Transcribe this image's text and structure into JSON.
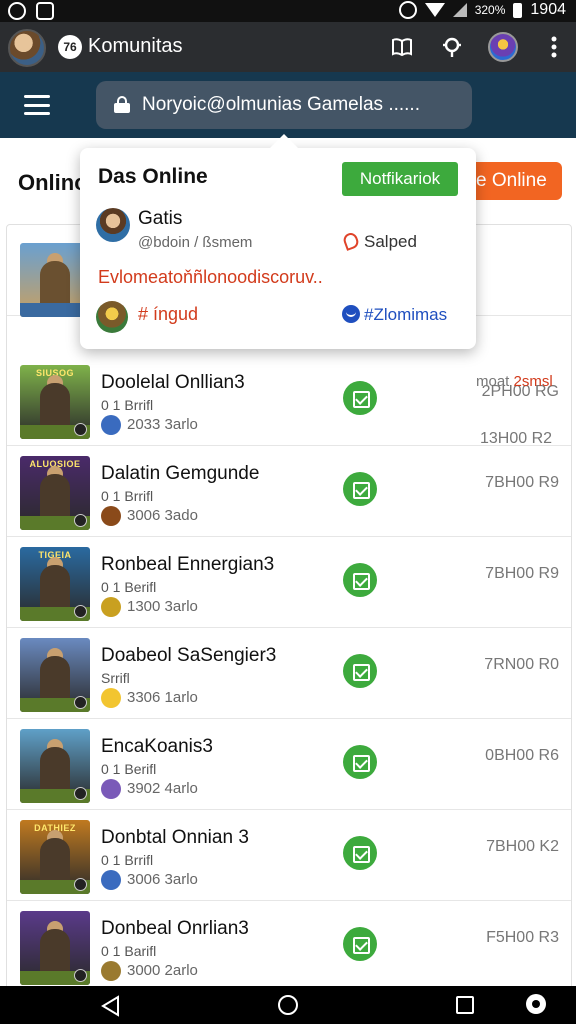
{
  "status_bar": {
    "time": "1904",
    "small": "320%"
  },
  "app_bar": {
    "logo": "76",
    "title": "Komunitas"
  },
  "search": {
    "text": "Noryoic@olmunias Gamelas ......"
  },
  "main": {
    "heading": "Onlinc",
    "online_button": "e Online"
  },
  "popup": {
    "title": "Das Online",
    "notify_button": "Notfikariok",
    "user_name": "Gatis",
    "user_handle": "@bdoin / ßsmem",
    "status": "Salped",
    "description": "Evlomeatoňñlonoodiscoruv..",
    "tag1": "# íngud",
    "tag2": "#Zlomimas"
  },
  "partial_row": {
    "text": "moat",
    "highlight": "2smsl",
    "time": "13H00 R2"
  },
  "games": [
    {
      "title": "Doolelal Onllian3",
      "sub": "0 1 Brrifl",
      "meta": "2033 3arlo",
      "time": "2PH00 RG",
      "banner": "SIUSOG",
      "sky": "#7fb24a",
      "av": "#3a6bbf"
    },
    {
      "title": "Dalatin Gemgunde",
      "sub": "0 1 Brrifl",
      "meta": "3006 3ado",
      "time": "7BH00 R9",
      "banner": "ALUOSIOE",
      "sky": "#4a2a6a",
      "av": "#8a4a1a"
    },
    {
      "title": "Ronbeal Ennergian3",
      "sub": "0 1 Berifl",
      "meta": "1300 3arlo",
      "time": "7BH00 R9",
      "banner": "TIGEIA",
      "sky": "#2a6aa0",
      "av": "#c9a020"
    },
    {
      "title": "Doabeol SaSengier3",
      "sub": "Srrifl",
      "meta": "3306 1arlo",
      "time": "7RN00 R0",
      "banner": "",
      "sky": "#6a8ac0",
      "av": "#f2c530"
    },
    {
      "title": "EncaKoanis3",
      "sub": "0 1 Berifl",
      "meta": "3902 4arlo",
      "time": "0BH00 R6",
      "banner": "",
      "sky": "#5fa0c8",
      "av": "#7a5ab8"
    },
    {
      "title": "Donbtal Onnian 3",
      "sub": "0 1 Brrifl",
      "meta": "3006 3arlo",
      "time": "7BH00 K2",
      "banner": "DATHIEZ",
      "sky": "#c07a20",
      "av": "#3a6bbf"
    },
    {
      "title": "Donbeal Onrlian3",
      "sub": "0 1 Barifl",
      "meta": "3000 2arlo",
      "time": "F5H00 R3",
      "banner": "",
      "sky": "#5a3a8a",
      "av": "#9a7a30"
    }
  ]
}
